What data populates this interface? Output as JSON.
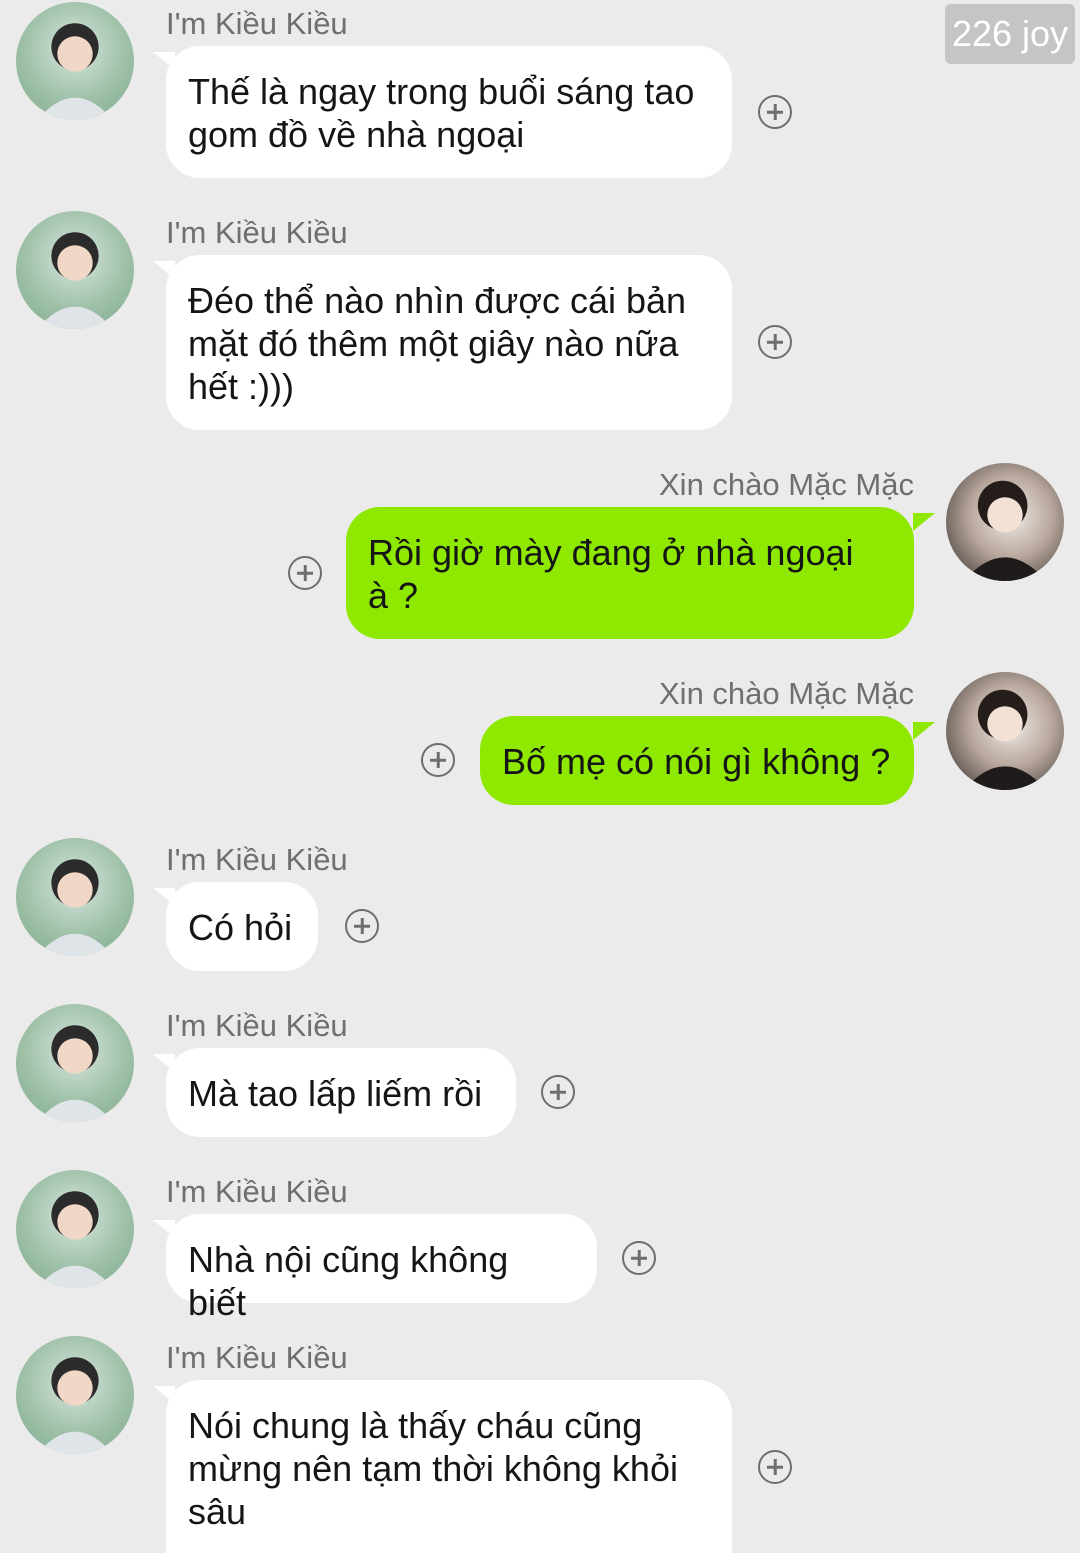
{
  "watermark": "226 joy",
  "contacts": {
    "kieu": {
      "name": "I'm Kiều Kiều"
    },
    "mac": {
      "name": "Xin chào Mặc Mặc"
    }
  },
  "messages": [
    {
      "from": "kieu",
      "name": "I'm Kiều Kiều",
      "text": "Thế là ngay trong buổi sáng tao\ngom đồ về nhà ngoại"
    },
    {
      "from": "kieu",
      "name": "I'm Kiều Kiều",
      "text": "Đéo thể nào nhìn được cái bản\nmặt đó thêm một giây nào nữa\nhết :)))"
    },
    {
      "from": "mac",
      "name": "Xin chào Mặc Mặc",
      "text": "Rồi giờ mày đang ở nhà ngoại\nà ?"
    },
    {
      "from": "mac",
      "name": "Xin chào Mặc Mặc",
      "text": "Bố mẹ có nói gì không ?"
    },
    {
      "from": "kieu",
      "name": "I'm Kiều Kiều",
      "text": "Có hỏi"
    },
    {
      "from": "kieu",
      "name": "I'm Kiều Kiều",
      "text": "Mà tao lấp liếm rồi"
    },
    {
      "from": "kieu",
      "name": "I'm Kiều Kiều",
      "text": "Nhà nội cũng không biết"
    },
    {
      "from": "kieu",
      "name": "I'm Kiều Kiều",
      "text": "Nói chung là thấy cháu cũng\nmừng nên tạm thời không khỏi\nsâu"
    }
  ],
  "icons": {
    "avatar_kieu": "person-avatar-icon",
    "avatar_mac": "person-avatar-icon",
    "add": "plus-circle-icon"
  },
  "colors": {
    "background": "#ebebeb",
    "incoming_bubble": "#ffffff",
    "outgoing_bubble": "#8ee800",
    "name_text": "#6f6f6f"
  }
}
